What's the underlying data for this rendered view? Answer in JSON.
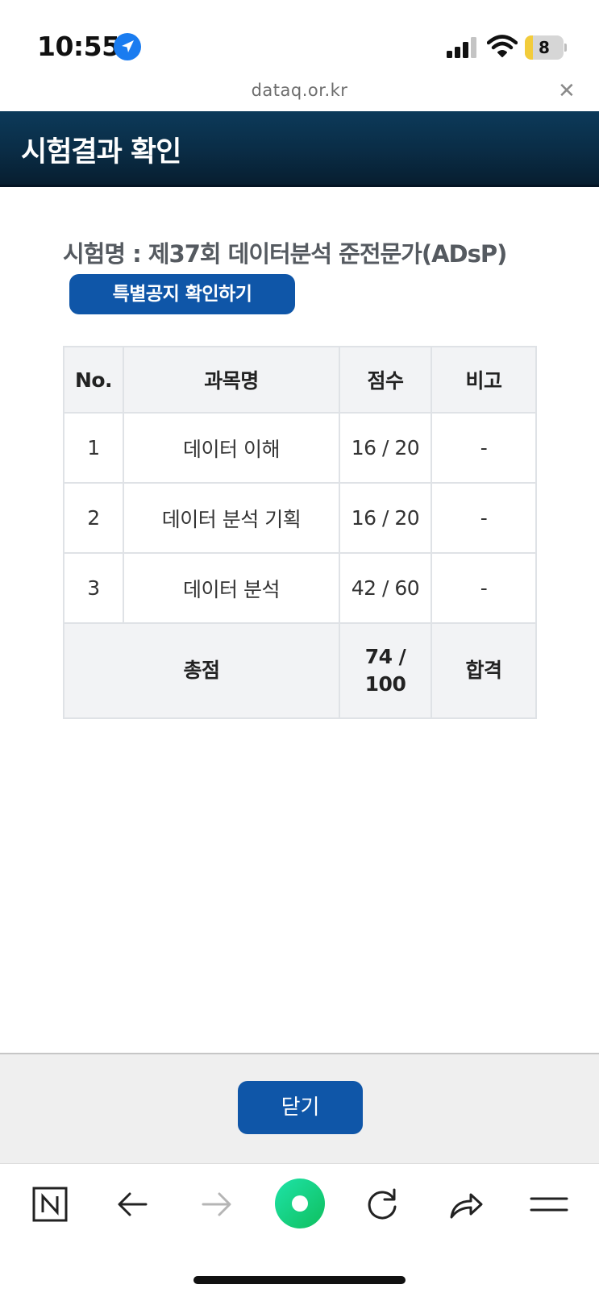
{
  "status_bar": {
    "time": "10:55",
    "location_icon": "location-arrow-icon",
    "signal_icon": "cellular-signal-icon",
    "wifi_icon": "wifi-icon",
    "battery_level": "8",
    "battery_color": "#f2cc3b"
  },
  "browser": {
    "url": "dataq.or.kr",
    "close_icon": "close-icon"
  },
  "header": {
    "title": "시험결과 확인",
    "color": "#0a2c45"
  },
  "exam": {
    "name": "시험명 : 제37회 데이터분석 준전문가(ADsP)",
    "notice_button": "특별공지 확인하기",
    "accent_color": "#0f56a8"
  },
  "table": {
    "headers": [
      "No.",
      "과목명",
      "점수",
      "비고"
    ],
    "rows": [
      {
        "no": "1",
        "subject": "데이터 이해",
        "score": "16 / 20",
        "note": "-"
      },
      {
        "no": "2",
        "subject": "데이터 분석 기획",
        "score": "16 / 20",
        "note": "-"
      },
      {
        "no": "3",
        "subject": "데이터 분석",
        "score": "42 / 60",
        "note": "-"
      }
    ],
    "total": {
      "label": "총점",
      "score_line1": "74 /",
      "score_line2": "100",
      "result": "합격"
    }
  },
  "footer": {
    "close_button": "닫기"
  },
  "toolbar": {
    "icons": [
      "naver-n-icon",
      "back-arrow-icon",
      "forward-arrow-icon",
      "green-dot-icon",
      "reload-icon",
      "share-icon",
      "menu-icon"
    ]
  }
}
